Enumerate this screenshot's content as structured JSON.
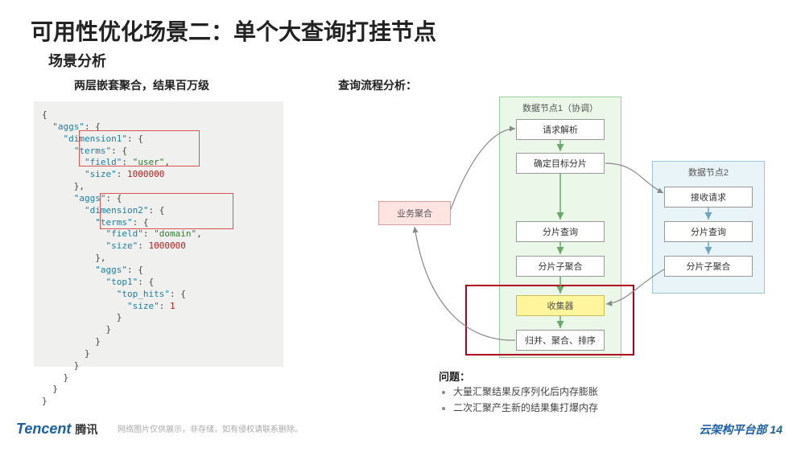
{
  "title": "可用性优化场景二：单个大查询打挂节点",
  "subtitle": "场景分析",
  "sub_left": "两层嵌套聚合，结果百万级",
  "sub_right": "查询流程分析：",
  "code": {
    "line01": "{",
    "line02": "  \"aggs\": {",
    "line03": "    \"dimension1\": {",
    "line04": "      \"terms\": {",
    "line05": "        \"field\": \"user\",",
    "line06": "        \"size\": 1000000",
    "line07": "      },",
    "line08": "      \"aggs\": {",
    "line09": "        \"dimension2\": {",
    "line10": "          \"terms\": {",
    "line11": "            \"field\": \"domain\",",
    "line12": "            \"size\": 1000000",
    "line13": "          },",
    "line14": "          \"aggs\": {",
    "line15": "            \"top1\": {",
    "line16": "              \"top_hits\": {",
    "line17": "                \"size\": 1",
    "line18": "              }",
    "line19": "            }",
    "line20": "          }",
    "line21": "        }",
    "line22": "      }",
    "line23": "    }",
    "line24": "  }",
    "line25": "}"
  },
  "diagram": {
    "node1_title": "数据节点1（协调）",
    "node2_title": "数据节点2",
    "biz": "业务聚合",
    "n1": {
      "a": "请求解析",
      "b": "确定目标分片",
      "c": "分片查询",
      "d": "分片子聚合",
      "e": "收集器",
      "f": "归并、聚合、排序"
    },
    "n2": {
      "a": "接收请求",
      "b": "分片查询",
      "c": "分片子聚合"
    }
  },
  "problem_label": "问题：",
  "problems": {
    "p1": "大量汇聚结果反序列化后内存膨胀",
    "p2": "二次汇聚产生新的结果集打爆内存"
  },
  "footer": {
    "brand_en": "Tencent",
    "brand_cn": "腾讯",
    "watermark": "网络图片仅供展示，非存储，如有侵权请联系删除。",
    "right": "云架构平台部 14"
  }
}
